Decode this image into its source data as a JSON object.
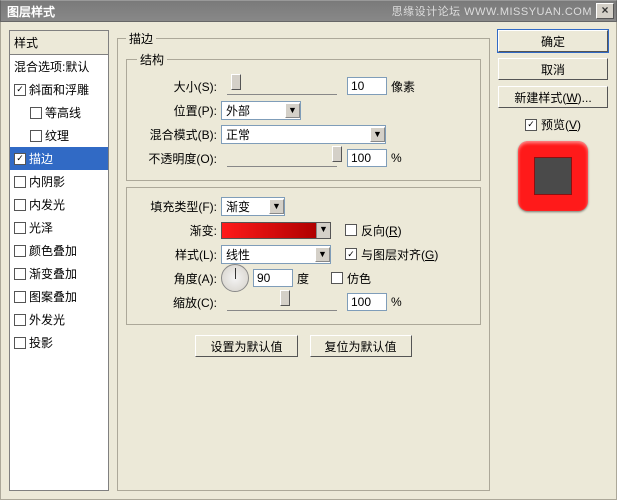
{
  "titlebar": {
    "title": "图层样式",
    "watermark": "思缘设计论坛  WWW.MISSYUAN.COM"
  },
  "left": {
    "header": "样式",
    "blend": "混合选项:默认",
    "items": [
      {
        "label": "斜面和浮雕",
        "checked": true,
        "indent": 0
      },
      {
        "label": "等高线",
        "checked": false,
        "indent": 1
      },
      {
        "label": "纹理",
        "checked": false,
        "indent": 1
      },
      {
        "label": "描边",
        "checked": true,
        "indent": 0,
        "active": true
      },
      {
        "label": "内阴影",
        "checked": false,
        "indent": 0
      },
      {
        "label": "内发光",
        "checked": false,
        "indent": 0
      },
      {
        "label": "光泽",
        "checked": false,
        "indent": 0
      },
      {
        "label": "颜色叠加",
        "checked": false,
        "indent": 0
      },
      {
        "label": "渐变叠加",
        "checked": false,
        "indent": 0
      },
      {
        "label": "图案叠加",
        "checked": false,
        "indent": 0
      },
      {
        "label": "外发光",
        "checked": false,
        "indent": 0
      },
      {
        "label": "投影",
        "checked": false,
        "indent": 0
      }
    ]
  },
  "center": {
    "legend_outer": "描边",
    "legend_struct": "结构",
    "size_label": "大小(S):",
    "size_value": "10",
    "size_unit": "像素",
    "pos_label": "位置(P):",
    "pos_value": "外部",
    "blend_label": "混合模式(B):",
    "blend_value": "正常",
    "opacity_label": "不透明度(O):",
    "opacity_value": "100",
    "opacity_unit": "%",
    "filltype_label": "填充类型(F):",
    "filltype_value": "渐变",
    "grad_label": "渐变:",
    "reverse_label": "反向(R)",
    "style_label": "样式(L):",
    "style_value": "线性",
    "align_label": "与图层对齐(G)",
    "angle_label": "角度(A):",
    "angle_value": "90",
    "angle_unit": "度",
    "dither_label": "仿色",
    "scale_label": "缩放(C):",
    "scale_value": "100",
    "scale_unit": "%",
    "btn_setdef": "设置为默认值",
    "btn_reset": "复位为默认值"
  },
  "right": {
    "ok": "确定",
    "cancel": "取消",
    "newstyle": "新建样式(W)...",
    "preview": "预览(V)",
    "colors": {
      "accent": "#ff1a1a",
      "inner": "#4a4a4a"
    }
  }
}
